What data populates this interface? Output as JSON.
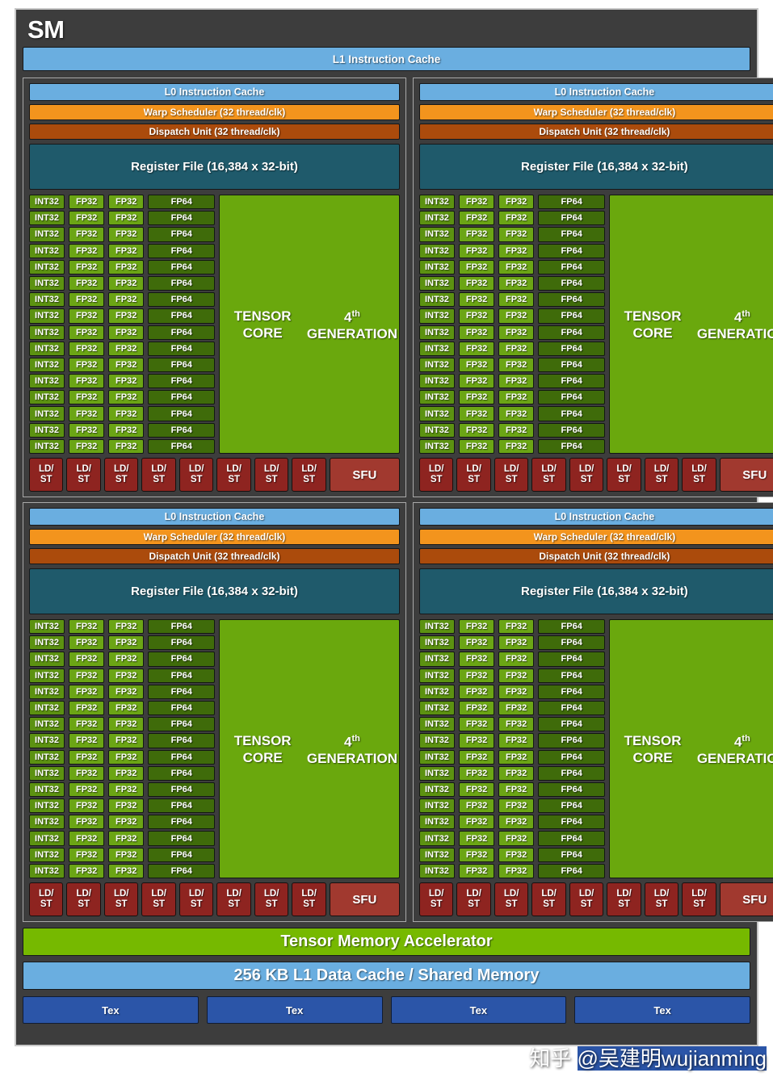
{
  "diagram": {
    "title": "SM",
    "l1_instruction_cache": "L1 Instruction Cache",
    "tensor_memory_accelerator": "Tensor Memory Accelerator",
    "l1_data_cache": "256 KB L1 Data Cache / Shared Memory",
    "tex_blocks": [
      "Tex",
      "Tex",
      "Tex",
      "Tex"
    ]
  },
  "partition": {
    "l0_instruction_cache": "L0 Instruction Cache",
    "warp_scheduler": "Warp Scheduler (32 thread/clk)",
    "dispatch_unit": "Dispatch Unit (32 thread/clk)",
    "register_file": "Register File (16,384 x 32-bit)",
    "tensor_core_line1": "TENSOR CORE",
    "tensor_core_line2_prefix": "4",
    "tensor_core_line2_sup": "th",
    "tensor_core_line2_suffix": " GENERATION",
    "core_rows": 16,
    "labels": {
      "int32": "INT32",
      "fp32": "FP32",
      "fp64": "FP64",
      "ldst_line1": "LD/",
      "ldst_line2": "ST",
      "sfu": "SFU"
    },
    "ldst_count": 8,
    "columns": [
      "INT32",
      "FP32",
      "FP32",
      "FP64"
    ]
  },
  "partitions": [
    {
      "id": "processing-block-1"
    },
    {
      "id": "processing-block-2"
    },
    {
      "id": "processing-block-3"
    },
    {
      "id": "processing-block-4"
    }
  ],
  "watermark": {
    "site": "知乎",
    "handle": "@吴建明wujianming"
  },
  "colors": {
    "background": "#3d3d3d",
    "cache_blue": "#6aaee0",
    "warp_orange": "#f3941d",
    "dispatch_brown": "#ab4b0c",
    "register_teal": "#1f5a6b",
    "int32_green": "#5c9211",
    "fp32_green": "#6ba515",
    "fp64_green": "#3f6b0a",
    "tensor_green": "#6aa80d",
    "tma_green": "#76b900",
    "ldst_red": "#8e2420",
    "sfu_red": "#a1392f",
    "tex_blue": "#2b55a8"
  }
}
